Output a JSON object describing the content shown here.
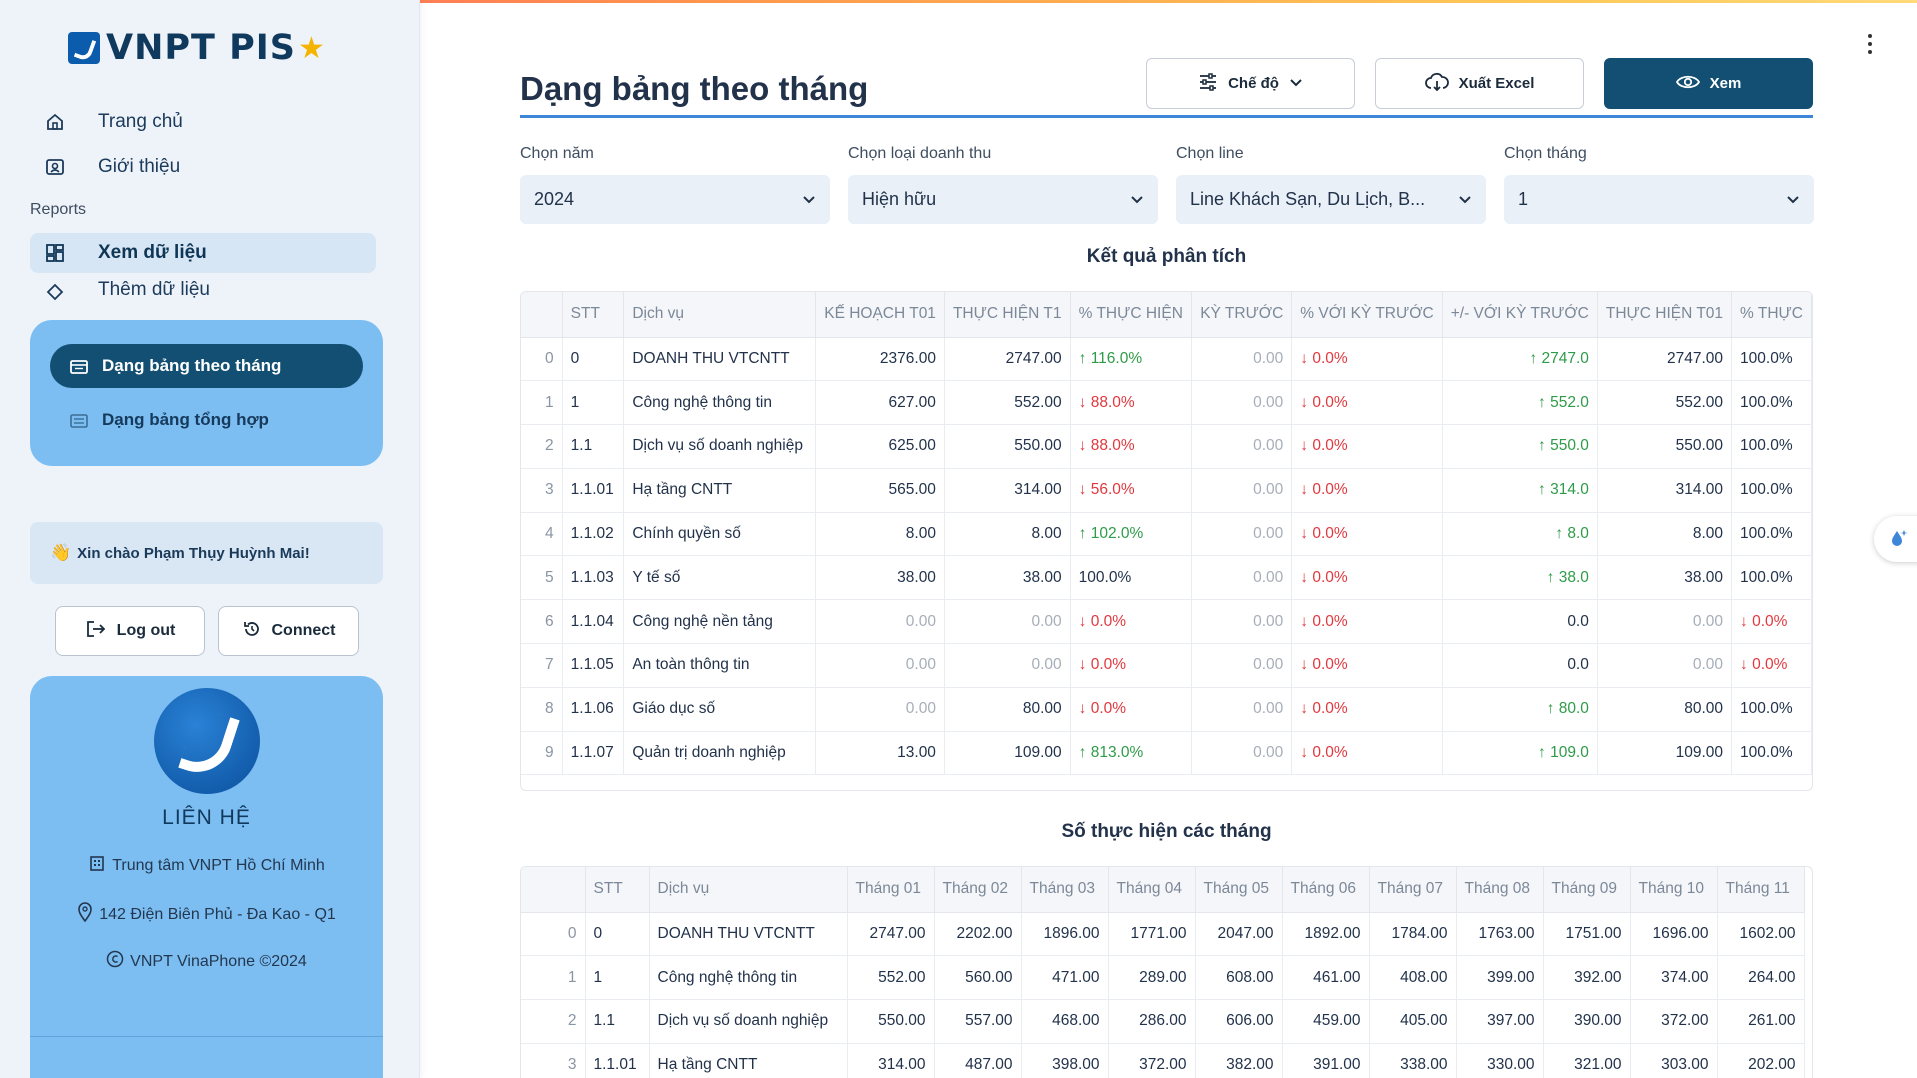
{
  "brand": {
    "name": "VNPT PIS",
    "star": "★"
  },
  "nav": {
    "home": "Trang chủ",
    "intro": "Giới thiệu",
    "reports_label": "Reports",
    "view_data": "Xem dữ liệu",
    "add_data": "Thêm dữ liệu"
  },
  "subnav": {
    "monthly": "Dạng bảng theo tháng",
    "summary": "Dạng bảng tổng hợp"
  },
  "greeting": {
    "wave": "👋",
    "text": "Xin chào Phạm Thụy Huỳnh Mai!"
  },
  "buttons": {
    "logout": "Log out",
    "connect": "Connect",
    "mode": "Chế độ",
    "export": "Xuất Excel",
    "view": "Xem"
  },
  "contact": {
    "title": "LIÊN HỆ",
    "center": "Trung tâm VNPT Hồ Chí Minh",
    "address": "142 Điện Biên Phủ - Đa Kao - Q1",
    "copyright": "VNPT VinaPhone ©2024"
  },
  "page_title": "Dạng bảng theo tháng",
  "filters": {
    "year": {
      "label": "Chọn năm",
      "value": "2024"
    },
    "revenue_type": {
      "label": "Chọn loại doanh thu",
      "value": "Hiện hữu"
    },
    "line": {
      "label": "Chọn line",
      "value": "Line Khách Sạn, Du Lịch, B..."
    },
    "month": {
      "label": "Chọn tháng",
      "value": "1"
    }
  },
  "analysis": {
    "title": "Kết quả phân tích",
    "headers": [
      "",
      "STT",
      "Dịch vụ",
      "KẾ HOẠCH T01",
      "THỰC HIỆN T1",
      "% THỰC HIỆN",
      "KỲ TRƯỚC",
      "% VỚI KỲ TRƯỚC",
      "+/- VỚI KỲ TRƯỚC",
      "THỰC HIỆN T01",
      "% THỰC"
    ],
    "rows": [
      [
        "0",
        "0",
        "DOANH THU VTCNTT",
        "2376.00",
        "2747.00",
        "↑ 116.0%",
        "0.00",
        "↓ 0.0%",
        "↑ 2747.0",
        "2747.00",
        "100.0%"
      ],
      [
        "1",
        "1",
        "Công nghệ thông tin",
        "627.00",
        "552.00",
        "↓ 88.0%",
        "0.00",
        "↓ 0.0%",
        "↑ 552.0",
        "552.00",
        "100.0%"
      ],
      [
        "2",
        "1.1",
        "Dịch vụ số doanh nghiệp",
        "625.00",
        "550.00",
        "↓ 88.0%",
        "0.00",
        "↓ 0.0%",
        "↑ 550.0",
        "550.00",
        "100.0%"
      ],
      [
        "3",
        "1.1.01",
        "Hạ tầng CNTT",
        "565.00",
        "314.00",
        "↓ 56.0%",
        "0.00",
        "↓ 0.0%",
        "↑ 314.0",
        "314.00",
        "100.0%"
      ],
      [
        "4",
        "1.1.02",
        "Chính quyền số",
        "8.00",
        "8.00",
        "↑ 102.0%",
        "0.00",
        "↓ 0.0%",
        "↑ 8.0",
        "8.00",
        "100.0%"
      ],
      [
        "5",
        "1.1.03",
        "Y tế số",
        "38.00",
        "38.00",
        "100.0%",
        "0.00",
        "↓ 0.0%",
        "↑ 38.0",
        "38.00",
        "100.0%"
      ],
      [
        "6",
        "1.1.04",
        "Công nghệ nền tảng",
        "0.00",
        "0.00",
        "↓ 0.0%",
        "0.00",
        "↓ 0.0%",
        "0.0",
        "0.00",
        "↓ 0.0%"
      ],
      [
        "7",
        "1.1.05",
        "An toàn thông tin",
        "0.00",
        "0.00",
        "↓ 0.0%",
        "0.00",
        "↓ 0.0%",
        "0.0",
        "0.00",
        "↓ 0.0%"
      ],
      [
        "8",
        "1.1.06",
        "Giáo dục số",
        "0.00",
        "80.00",
        "↓ 0.0%",
        "0.00",
        "↓ 0.0%",
        "↑ 80.0",
        "80.00",
        "100.0%"
      ],
      [
        "9",
        "1.1.07",
        "Quản trị doanh nghiệp",
        "13.00",
        "109.00",
        "↑ 813.0%",
        "0.00",
        "↓ 0.0%",
        "↑ 109.0",
        "109.00",
        "100.0%"
      ]
    ]
  },
  "monthly": {
    "title": "Số thực hiện các tháng",
    "headers": [
      "",
      "STT",
      "Dịch vụ",
      "Tháng 01",
      "Tháng 02",
      "Tháng 03",
      "Tháng 04",
      "Tháng 05",
      "Tháng 06",
      "Tháng 07",
      "Tháng 08",
      "Tháng 09",
      "Tháng 10",
      "Tháng 11"
    ],
    "rows": [
      [
        "0",
        "0",
        "DOANH THU VTCNTT",
        "2747.00",
        "2202.00",
        "1896.00",
        "1771.00",
        "2047.00",
        "1892.00",
        "1784.00",
        "1763.00",
        "1751.00",
        "1696.00",
        "1602.00"
      ],
      [
        "1",
        "1",
        "Công nghệ thông tin",
        "552.00",
        "560.00",
        "471.00",
        "289.00",
        "608.00",
        "461.00",
        "408.00",
        "399.00",
        "392.00",
        "374.00",
        "264.00"
      ],
      [
        "2",
        "1.1",
        "Dịch vụ số doanh nghiệp",
        "550.00",
        "557.00",
        "468.00",
        "286.00",
        "606.00",
        "459.00",
        "405.00",
        "397.00",
        "390.00",
        "372.00",
        "261.00"
      ],
      [
        "3",
        "1.1.01",
        "Hạ tầng CNTT",
        "314.00",
        "487.00",
        "398.00",
        "372.00",
        "382.00",
        "391.00",
        "338.00",
        "330.00",
        "321.00",
        "303.00",
        "202.00"
      ]
    ]
  },
  "colors": {
    "primary": "#124f73",
    "accent": "#3d86d8",
    "up": "#2e9b48",
    "down": "#e0383e"
  }
}
